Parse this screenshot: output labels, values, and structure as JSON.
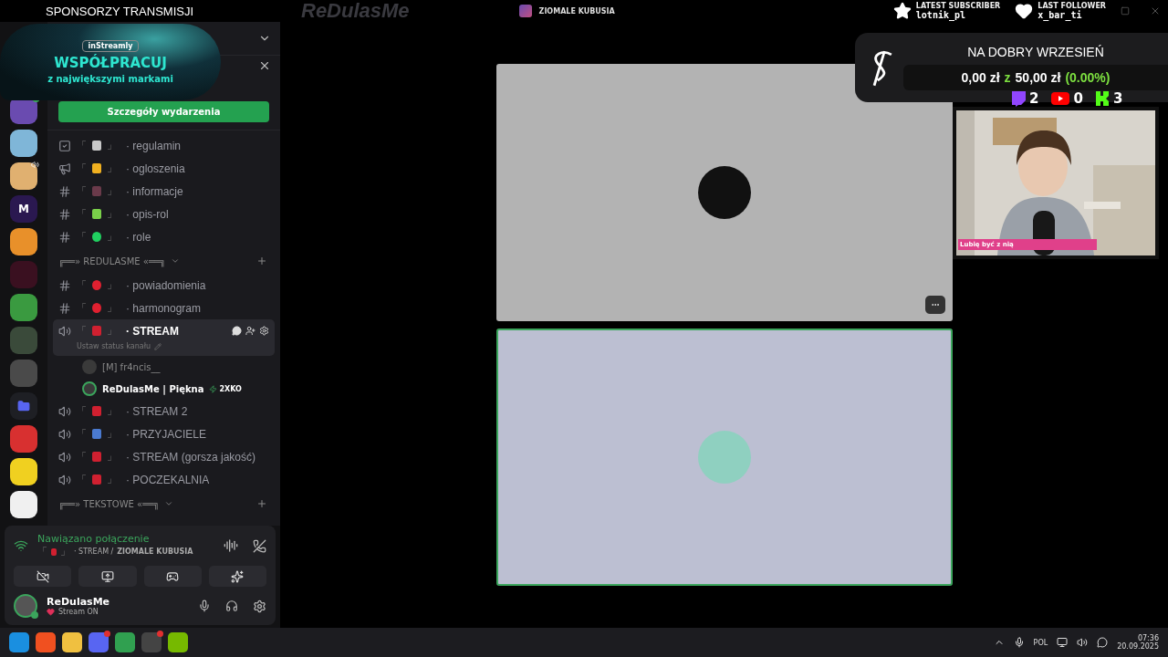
{
  "top_bar": {
    "sponsor_title": "SPONSORZY TRANSMISJI",
    "logo": "ReDulasMe",
    "server_title": "ZIOMALE KUBUSIA",
    "latest_subscriber": {
      "label": "LATEST SUBSCRIBER",
      "name": "lotnik_pl"
    },
    "last_follower": {
      "label": "LAST FOLLOWER",
      "name": "x_bar_ti"
    }
  },
  "sponsor_banner": {
    "brand": "inStreamly",
    "headline": "WSPÓŁPRACUJ",
    "subline": "z największymi markami"
  },
  "event": {
    "button": "Szczegóły wydarzenia"
  },
  "servers": [
    {
      "color": "#6a4bb0",
      "badge": true
    },
    {
      "color": "#7fb6d8"
    },
    {
      "color": "#e0b070",
      "speaker": true
    },
    {
      "color": "#2a1850",
      "letter": "M"
    },
    {
      "color": "#e8902a"
    },
    {
      "color": "#3a1020"
    },
    {
      "color": "#3a9a40"
    },
    {
      "color": "#3a4a3a"
    },
    {
      "color": "#4a4a4a"
    },
    {
      "kind": "folder",
      "color": "#5865f2"
    },
    {
      "color": "#d83030"
    },
    {
      "color": "#f0d020"
    },
    {
      "color": "#f0f0f0"
    }
  ],
  "channels": [
    {
      "kind": "rules",
      "open": "「",
      "color": "#c8c8c8",
      "close": "」",
      "name": "· regulamin",
      "selected": false
    },
    {
      "kind": "announce",
      "open": "「",
      "color": "#f0b020",
      "close": "」",
      "name": "· ogloszenia",
      "selected": false
    },
    {
      "kind": "text",
      "open": "「",
      "color": "#6a3a4a",
      "close": "」",
      "name": "· informacje",
      "selected": false
    },
    {
      "kind": "text",
      "open": "「",
      "color": "#7ad04a",
      "close": "」",
      "name": "· opis-rol",
      "selected": false
    },
    {
      "kind": "locked",
      "open": "「",
      "color": "#20d060",
      "close": "」",
      "name": "· role",
      "selected": false
    },
    {
      "kind": "category",
      "name": "╔══» REDULASME «══╗"
    },
    {
      "kind": "locked",
      "open": "「",
      "color": "#e02030",
      "close": "」",
      "name": "· powiadomienia",
      "selected": false
    },
    {
      "kind": "locked",
      "open": "「",
      "color": "#e02030",
      "close": "」",
      "name": "· harmonogram",
      "selected": false
    },
    {
      "kind": "voice",
      "open": "「",
      "color": "#d02030",
      "close": "」",
      "name": "· STREAM",
      "selected": true,
      "status": "Ustaw status kanału",
      "users": [
        {
          "name": "[M] fr4ncis__",
          "active": false
        },
        {
          "name": "ReDulasMe | Piękna",
          "active": true,
          "activity": "2XKO"
        }
      ]
    },
    {
      "kind": "voice",
      "open": "「",
      "color": "#d02030",
      "close": "」",
      "name": "· STREAM 2",
      "selected": false
    },
    {
      "kind": "voice",
      "open": "「",
      "color": "#4a7ad0",
      "close": "」",
      "name": "· PRZYJACIELE",
      "selected": false
    },
    {
      "kind": "voice",
      "open": "「",
      "color": "#d02030",
      "close": "」",
      "name": "· STREAM (gorsza jakość)",
      "selected": false
    },
    {
      "kind": "voice",
      "open": "「",
      "color": "#d02030",
      "close": "」",
      "name": "· POCZEKALNIA",
      "selected": false
    },
    {
      "kind": "category",
      "name": "╔══» TEKSTOWE «══╗"
    }
  ],
  "voice_panel": {
    "status": "Nawiązano połączenie",
    "open": "「",
    "color": "#d02030",
    "close": "」",
    "channel": "· STREAM /",
    "server": "ZIOMALE KUBUSIA"
  },
  "user": {
    "name": "ReDulasMe",
    "status": "Stream ON"
  },
  "tiles": [
    {
      "kind": "dark",
      "speaking": false
    },
    {
      "kind": "anime",
      "speaking": true
    }
  ],
  "goal": {
    "title": "NA DOBRY WRZESIEŃ",
    "current": "0,00 zł",
    "separator": "z",
    "target": "50,00 zł",
    "percent": "(0.00%)",
    "level": 0
  },
  "platforms": [
    {
      "kind": "twitch",
      "count": "2"
    },
    {
      "kind": "youtube",
      "count": "0"
    },
    {
      "kind": "kick",
      "count": "3"
    }
  ],
  "webcam": {
    "caption": "Lubię być z nią"
  },
  "taskbar": {
    "apps": [
      {
        "kind": "windows"
      },
      {
        "kind": "brave"
      },
      {
        "kind": "files"
      },
      {
        "kind": "discord",
        "badge": true
      },
      {
        "kind": "chrome"
      },
      {
        "kind": "obs",
        "badge": true
      },
      {
        "kind": "nvidia"
      }
    ],
    "language": "POL",
    "time": "07:36",
    "date": "20.09.2025"
  }
}
